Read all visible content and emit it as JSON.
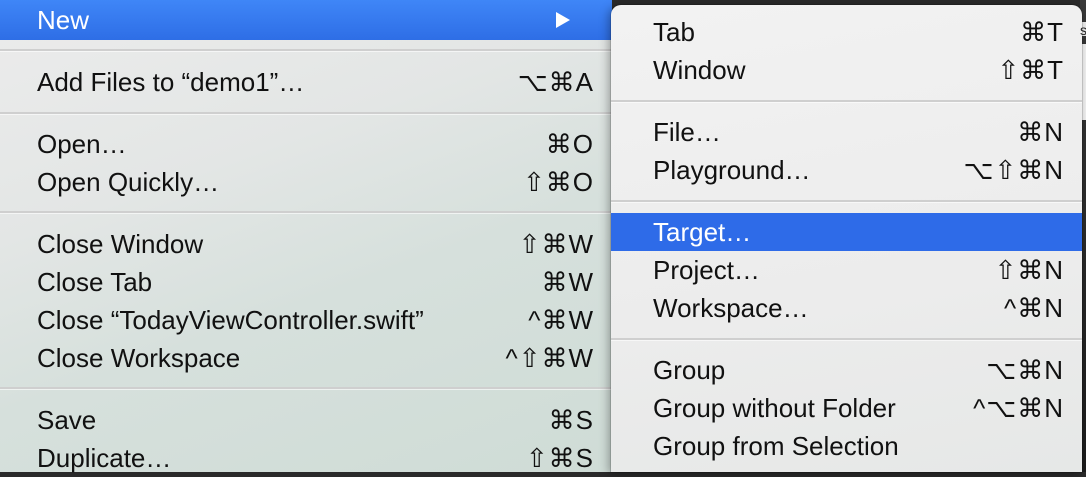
{
  "main_menu": {
    "items": [
      {
        "label": "New",
        "shortcut": ""
      },
      {
        "label": "Add Files to “demo1”…",
        "shortcut": "⌥⌘A"
      },
      {
        "label": "Open…",
        "shortcut": "⌘O"
      },
      {
        "label": "Open Quickly…",
        "shortcut": "⇧⌘O"
      },
      {
        "label": "Close Window",
        "shortcut": "⇧⌘W"
      },
      {
        "label": "Close Tab",
        "shortcut": "⌘W"
      },
      {
        "label": "Close “TodayViewController.swift”",
        "shortcut": "^⌘W"
      },
      {
        "label": "Close Workspace",
        "shortcut": "^⇧⌘W"
      },
      {
        "label": "Save",
        "shortcut": "⌘S"
      },
      {
        "label": "Duplicate…",
        "shortcut": "⇧⌘S"
      }
    ]
  },
  "submenu": {
    "items": [
      {
        "label": "Tab",
        "shortcut": "⌘T"
      },
      {
        "label": "Window",
        "shortcut": "⇧⌘T"
      },
      {
        "label": "File…",
        "shortcut": "⌘N"
      },
      {
        "label": "Playground…",
        "shortcut": "⌥⇧⌘N"
      },
      {
        "label": "Target…",
        "shortcut": ""
      },
      {
        "label": "Project…",
        "shortcut": "⇧⌘N"
      },
      {
        "label": "Workspace…",
        "shortcut": "^⌘N"
      },
      {
        "label": "Group",
        "shortcut": "⌥⌘N"
      },
      {
        "label": "Group without Folder",
        "shortcut": "^⌥⌘N"
      },
      {
        "label": "Group from Selection",
        "shortcut": ""
      }
    ]
  },
  "colors": {
    "highlight": "#2e6be8",
    "menu_background": "#ececec"
  },
  "background_peek_text": "s"
}
